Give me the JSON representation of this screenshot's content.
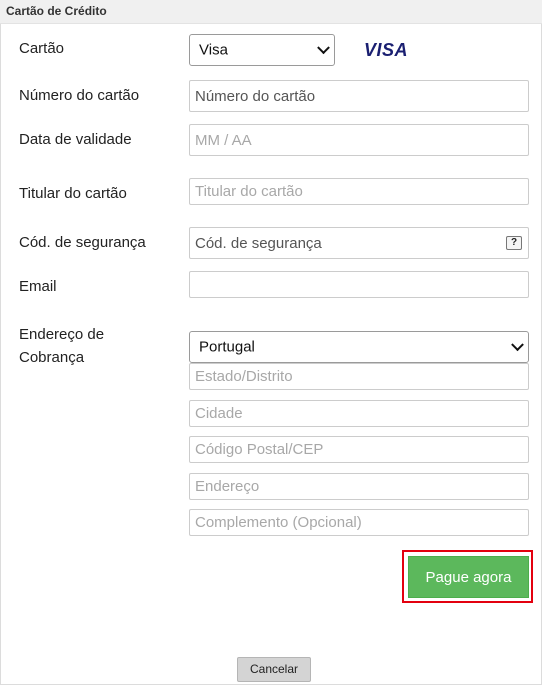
{
  "header": {
    "title": "Cartão de Crédito"
  },
  "form": {
    "card_label": "Cartão",
    "card_selected": "Visa",
    "card_brand": "VISA",
    "number_label": "Número do cartão",
    "number_placeholder": "Número do cartão",
    "expiry_label": "Data de validade",
    "expiry_placeholder": "MM / AA",
    "holder_label": "Titular do cartão",
    "holder_placeholder": "Titular do cartão",
    "cvv_label": "Cód. de segurança",
    "cvv_placeholder": "Cód. de segurança",
    "cvv_help": "?",
    "email_label": "Email",
    "email_value": "",
    "billing_label_1": "Endereço de",
    "billing_label_2": "Cobrança",
    "country_selected": "Portugal",
    "state_placeholder": "Estado/Distrito",
    "city_placeholder": "Cidade",
    "zip_placeholder": "Código Postal/CEP",
    "address_placeholder": "Endereço",
    "complement_placeholder": "Complemento (Opcional)"
  },
  "actions": {
    "pay_label": "Pague agora",
    "cancel_label": "Cancelar"
  },
  "colors": {
    "pay_button": "#5cb85c",
    "highlight_outline": "#e3000f",
    "visa_blue": "#1a1f71"
  }
}
